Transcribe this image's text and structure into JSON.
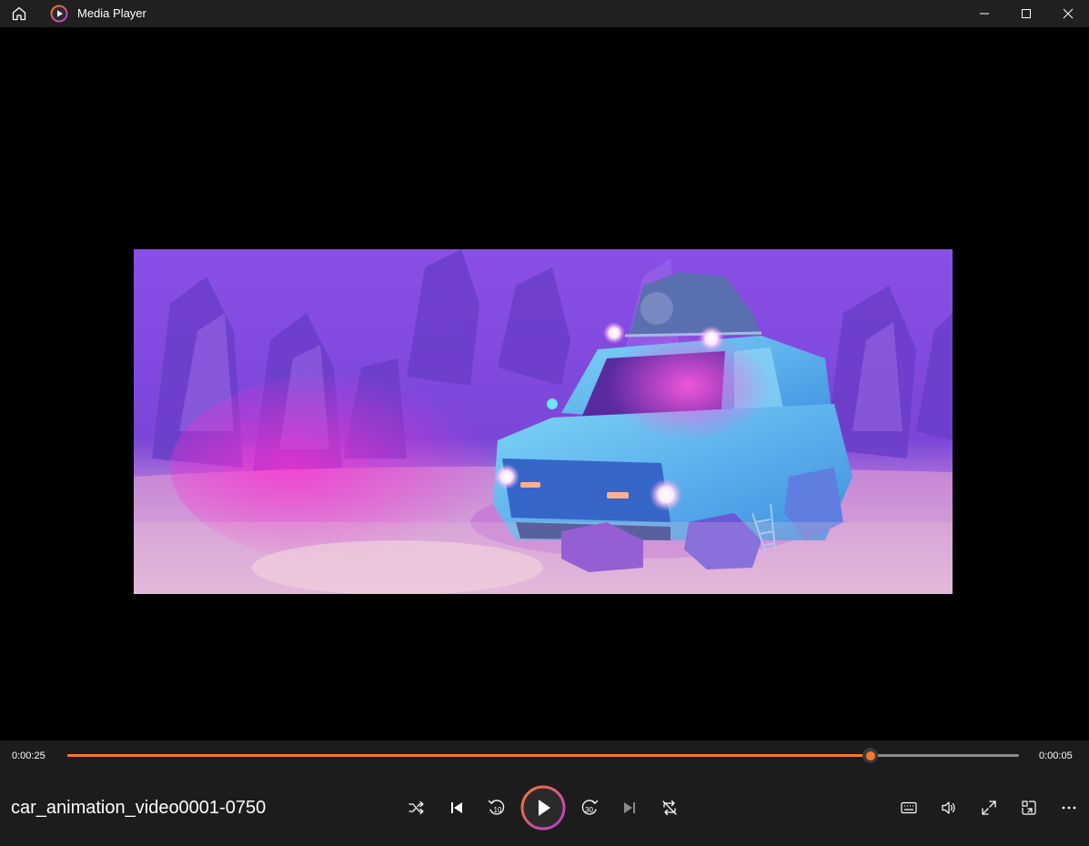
{
  "window": {
    "title": "Media Player",
    "home_icon": "home-icon",
    "app_icon": "media-player-app-icon",
    "controls": [
      "minimize-icon",
      "maximize-icon",
      "close-icon"
    ]
  },
  "player": {
    "elapsed": "0:00:25",
    "remaining": "0:00:05",
    "progress": 0.844,
    "media_title": "car_animation_video0001-0750",
    "accent_color": "#f47a2a",
    "skip_back_seconds": "10",
    "skip_forward_seconds": "30",
    "transport_icons": [
      "shuffle-icon",
      "previous-icon",
      "skip-back-10-icon",
      "play-icon",
      "skip-forward-30-icon",
      "next-icon",
      "repeat-icon"
    ],
    "right_icons": [
      "captions-icon",
      "volume-icon",
      "fullscreen-icon",
      "mini-player-icon",
      "more-icon"
    ]
  },
  "video": {
    "scene": "animated-car-frame"
  }
}
